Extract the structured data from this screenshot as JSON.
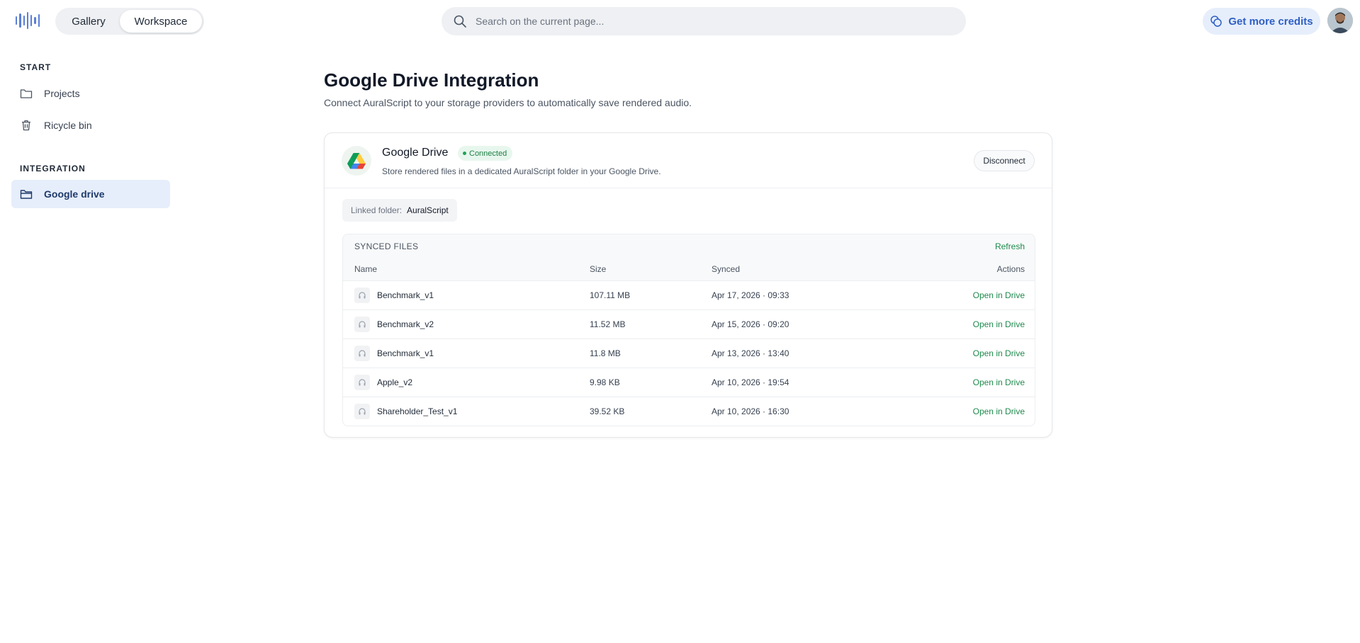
{
  "header": {
    "tabs": [
      {
        "label": "Gallery",
        "active": false
      },
      {
        "label": "Workspace",
        "active": true
      }
    ],
    "search": {
      "placeholder": "Search on the current page...",
      "value": ""
    },
    "credits_label": "Get more credits"
  },
  "sidebar": {
    "sections": [
      {
        "label": "START",
        "items": [
          {
            "label": "Projects",
            "icon": "folder-icon"
          },
          {
            "label": "Ricycle bin",
            "icon": "trash-icon"
          }
        ]
      },
      {
        "label": "INTEGRATION",
        "items": [
          {
            "label": "Google drive",
            "icon": "folder-open-icon",
            "active": true
          }
        ]
      }
    ]
  },
  "main": {
    "title": "Google Drive Integration",
    "subtitle": "Connect AuralScript to your storage providers to automatically save rendered audio.",
    "provider": {
      "name": "Google Drive",
      "status": "Connected",
      "description": "Store rendered files in a dedicated AuralScript folder in your Google Drive.",
      "disconnect_label": "Disconnect"
    },
    "linked_folder": {
      "label": "Linked folder:",
      "value": "AuralScript"
    },
    "synced_files": {
      "title": "SYNCED FILES",
      "refresh_label": "Refresh",
      "columns": {
        "name": "Name",
        "size": "Size",
        "synced": "Synced",
        "actions": "Actions"
      },
      "rows": [
        {
          "name": "Benchmark_v1",
          "size": "107.11 MB",
          "synced": "Apr 17, 2026 · 09:33",
          "action": "Open in Drive"
        },
        {
          "name": "Benchmark_v2",
          "size": "11.52 MB",
          "synced": "Apr 15, 2026 · 09:20",
          "action": "Open in Drive"
        },
        {
          "name": "Benchmark_v1",
          "size": "11.8 MB",
          "synced": "Apr 13, 2026 · 13:40",
          "action": "Open in Drive"
        },
        {
          "name": "Apple_v2",
          "size": "9.98 KB",
          "synced": "Apr 10, 2026 · 19:54",
          "action": "Open in Drive"
        },
        {
          "name": "Shareholder_Test_v1",
          "size": "39.52 KB",
          "synced": "Apr 10, 2026 · 16:30",
          "action": "Open in Drive"
        }
      ]
    }
  },
  "colors": {
    "accent_blue": "#2f5fc4",
    "active_nav_bg": "#e6eefb",
    "success_green": "#1e8a4c",
    "badge_bg": "#e8f7ee"
  }
}
